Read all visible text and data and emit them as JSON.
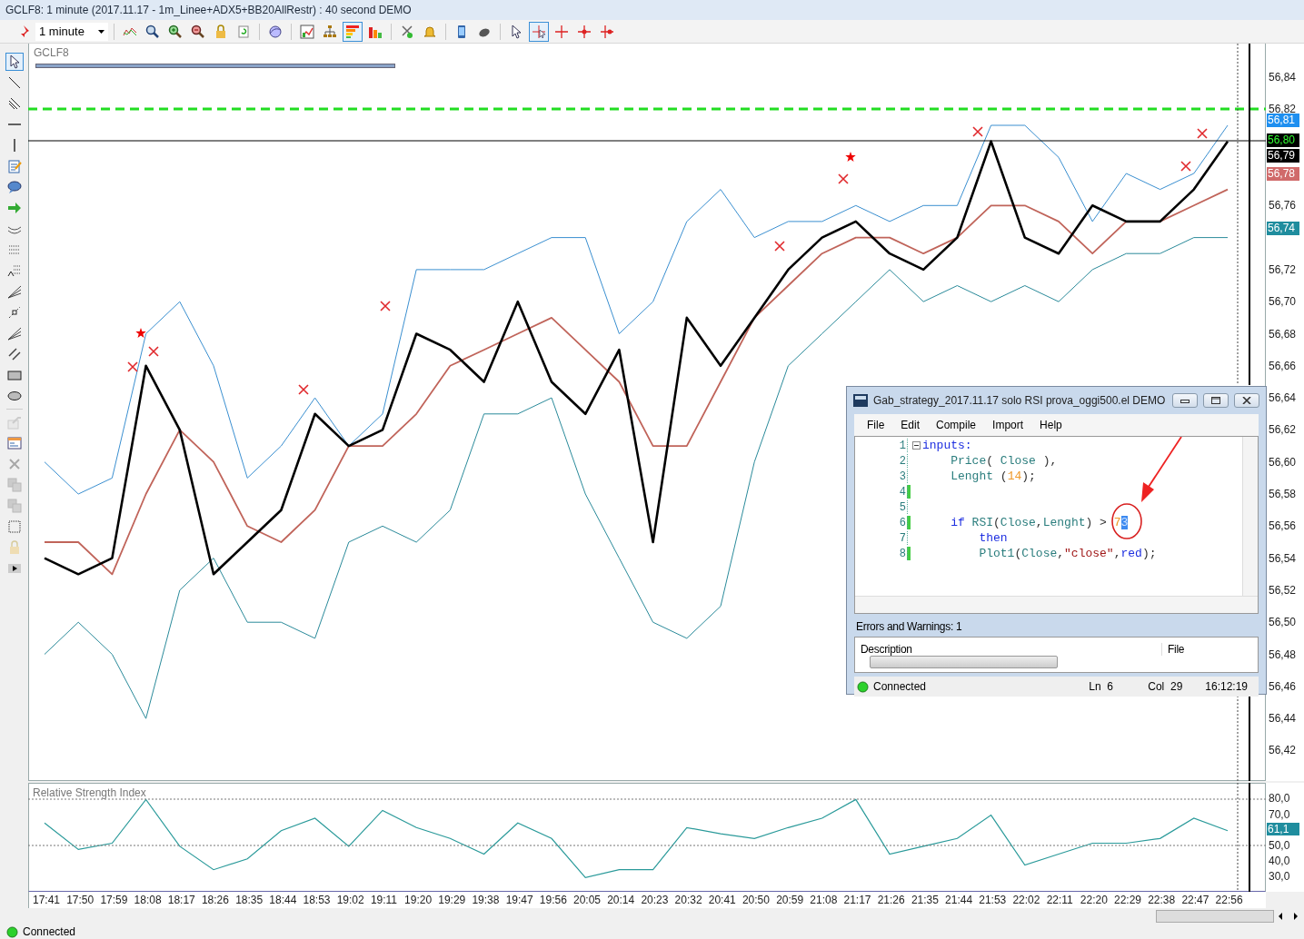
{
  "window": {
    "title": "GCLF8: 1 minute (2017.11.17 - 1m_Linee+ADX5+BB20AllRestr) : 40 second DEMO"
  },
  "toolbar": {
    "interval": "1 minute",
    "groups": [
      [
        {
          "kind": "pin",
          "selected": false
        }
      ],
      [
        {
          "kind": "indicator",
          "selected": false
        },
        {
          "kind": "zoom",
          "selected": false
        },
        {
          "kind": "zoom-in",
          "selected": false
        },
        {
          "kind": "zoom-out",
          "selected": false
        },
        {
          "kind": "lock",
          "selected": false
        },
        {
          "kind": "refresh",
          "selected": false
        }
      ],
      [
        {
          "kind": "globe",
          "selected": false
        }
      ],
      [
        {
          "kind": "chart",
          "selected": false
        },
        {
          "kind": "tree",
          "selected": false
        },
        {
          "kind": "colorbars",
          "selected": true
        },
        {
          "kind": "bars",
          "selected": false
        }
      ],
      [
        {
          "kind": "scissors",
          "selected": false
        },
        {
          "kind": "bell",
          "selected": false
        }
      ],
      [
        {
          "kind": "phone",
          "selected": false
        },
        {
          "kind": "mouse",
          "selected": false
        }
      ],
      [
        {
          "kind": "pointer",
          "selected": false
        },
        {
          "kind": "crosshair",
          "selected": true
        },
        {
          "kind": "cross",
          "selected": false
        },
        {
          "kind": "cross-dot",
          "selected": false
        },
        {
          "kind": "cross-dot-right",
          "selected": false
        }
      ]
    ]
  },
  "drawing_tools": [
    {
      "kind": "pointer",
      "selected": true,
      "disabled": false
    },
    {
      "kind": "line",
      "selected": false,
      "disabled": false
    },
    {
      "kind": "parallel",
      "selected": false,
      "disabled": false
    },
    {
      "kind": "hline",
      "selected": false,
      "disabled": false
    },
    {
      "kind": "vline",
      "selected": false,
      "disabled": false
    },
    {
      "kind": "note",
      "selected": false,
      "disabled": false
    },
    {
      "kind": "callout",
      "selected": false,
      "disabled": false
    },
    {
      "kind": "arrow",
      "selected": false,
      "disabled": false
    },
    {
      "kind": "arc",
      "selected": false,
      "disabled": false
    },
    {
      "kind": "dots",
      "selected": false,
      "disabled": false
    },
    {
      "kind": "fib",
      "selected": false,
      "disabled": false
    },
    {
      "kind": "fan",
      "selected": false,
      "disabled": false
    },
    {
      "kind": "segment",
      "selected": false,
      "disabled": false
    },
    {
      "kind": "fan",
      "selected": false,
      "disabled": false
    },
    {
      "kind": "channel",
      "selected": false,
      "disabled": false
    },
    {
      "kind": "rect",
      "selected": false,
      "disabled": false
    },
    {
      "kind": "ellipse",
      "selected": false,
      "disabled": false
    },
    {
      "kind": "props",
      "selected": false,
      "disabled": true
    },
    {
      "kind": "panel",
      "selected": false,
      "disabled": false
    },
    {
      "kind": "delete",
      "selected": false,
      "disabled": true
    },
    {
      "kind": "copy",
      "selected": false,
      "disabled": true
    },
    {
      "kind": "copy",
      "selected": false,
      "disabled": true
    },
    {
      "kind": "select",
      "selected": false,
      "disabled": false
    },
    {
      "kind": "lock",
      "selected": false,
      "disabled": true
    },
    {
      "kind": "expand",
      "selected": false,
      "disabled": false
    }
  ],
  "price_panel": {
    "symbol": "GCLF8",
    "chart_data": {
      "type": "line",
      "ylim": [
        56.401,
        56.861
      ],
      "yticks": [
        {
          "value": 56.84,
          "label": "56,84"
        },
        {
          "value": 56.82,
          "label": "56,82"
        },
        {
          "value": 56.76,
          "label": "56,76"
        },
        {
          "value": 56.72,
          "label": "56,72"
        },
        {
          "value": 56.7,
          "label": "56,70"
        },
        {
          "value": 56.68,
          "label": "56,68"
        },
        {
          "value": 56.66,
          "label": "56,66"
        },
        {
          "value": 56.64,
          "label": "56,64"
        },
        {
          "value": 56.62,
          "label": "56,62"
        },
        {
          "value": 56.6,
          "label": "56,60"
        },
        {
          "value": 56.58,
          "label": "56,58"
        },
        {
          "value": 56.56,
          "label": "56,56"
        },
        {
          "value": 56.54,
          "label": "56,54"
        },
        {
          "value": 56.52,
          "label": "56,52"
        },
        {
          "value": 56.5,
          "label": "56,50"
        },
        {
          "value": 56.48,
          "label": "56,48"
        },
        {
          "value": 56.46,
          "label": "56,46"
        },
        {
          "value": 56.44,
          "label": "56,44"
        },
        {
          "value": 56.42,
          "label": "56,42"
        }
      ],
      "series": [
        {
          "color": "#3a8fd0",
          "values": [
            56.6,
            56.58,
            56.59,
            56.68,
            56.7,
            56.66,
            56.59,
            56.61,
            56.64,
            56.61,
            56.63,
            56.72,
            56.72,
            56.72,
            56.73,
            56.74,
            56.74,
            56.68,
            56.7,
            56.75,
            56.77,
            56.74,
            56.75,
            56.75,
            56.76,
            56.75,
            56.76,
            56.76,
            56.81,
            56.81,
            56.79,
            56.75,
            56.78,
            56.77,
            56.78,
            56.81
          ]
        },
        {
          "color": "#2a8a9a",
          "values": [
            56.48,
            56.5,
            56.48,
            56.44,
            56.52,
            56.54,
            56.5,
            56.5,
            56.49,
            56.55,
            56.56,
            56.55,
            56.57,
            56.63,
            56.63,
            56.64,
            56.58,
            56.54,
            56.5,
            56.49,
            56.51,
            56.6,
            56.66,
            56.68,
            56.7,
            56.72,
            56.7,
            56.71,
            56.7,
            56.71,
            56.7,
            56.72,
            56.73,
            56.73,
            56.74,
            56.74
          ]
        },
        {
          "color": "#c0645a",
          "values": [
            56.55,
            56.55,
            56.53,
            56.58,
            56.62,
            56.6,
            56.56,
            56.55,
            56.57,
            56.61,
            56.61,
            56.63,
            56.66,
            56.67,
            56.68,
            56.69,
            56.67,
            56.65,
            56.61,
            56.61,
            56.65,
            56.69,
            56.71,
            56.73,
            56.74,
            56.74,
            56.73,
            56.74,
            56.76,
            56.76,
            56.75,
            56.73,
            56.75,
            56.75,
            56.76,
            56.77
          ]
        },
        {
          "color": "#000000",
          "values": [
            56.54,
            56.53,
            56.54,
            56.66,
            56.62,
            56.53,
            56.55,
            56.57,
            56.63,
            56.61,
            56.62,
            56.68,
            56.67,
            56.65,
            56.7,
            56.65,
            56.63,
            56.67,
            56.55,
            56.69,
            56.66,
            56.69,
            56.72,
            56.74,
            56.75,
            56.73,
            56.72,
            56.74,
            56.8,
            56.74,
            56.73,
            56.76,
            56.75,
            56.75,
            56.77,
            56.8
          ]
        }
      ]
    },
    "value_labels": [
      {
        "text": "56,81",
        "color": "#1e8ff0"
      },
      {
        "text": "56,80",
        "color": "#000000"
      },
      {
        "text": "56,79",
        "color": "#000000"
      },
      {
        "text": "56,78",
        "color": "#d06a6a"
      },
      {
        "text": "56,74",
        "color": "#1f8d9e"
      }
    ]
  },
  "rsi_panel": {
    "title": "Relative Strength Index",
    "chart_data": {
      "type": "line",
      "categories": [
        "17:41",
        "17:50",
        "17:59",
        "18:08",
        "18:17",
        "18:26",
        "18:35",
        "18:44",
        "18:53",
        "19:02",
        "19:11",
        "19:20",
        "19:29",
        "19:38",
        "19:47",
        "19:56",
        "20:05",
        "20:14",
        "20:23",
        "20:32",
        "20:41",
        "20:50",
        "20:59",
        "21:08",
        "21:17",
        "21:26",
        "21:35",
        "21:44",
        "21:53",
        "22:02",
        "22:11",
        "22:20",
        "22:29",
        "22:38",
        "22:47",
        "22:56"
      ],
      "ylim": [
        20.3,
        90.1
      ],
      "yticks": [
        {
          "value": 80,
          "label": "80,0"
        },
        {
          "value": 70,
          "label": "70,0"
        },
        {
          "value": 50,
          "label": "50,0"
        },
        {
          "value": 40,
          "label": "40,0"
        },
        {
          "value": 30,
          "label": "30,0"
        }
      ],
      "series": [
        {
          "color": "#2a9a9a",
          "values": [
            65,
            48,
            52,
            80,
            50,
            35,
            42,
            60,
            68,
            50,
            73,
            62,
            55,
            45,
            65,
            55,
            30,
            35,
            35,
            62,
            58,
            55,
            62,
            68,
            80,
            45,
            50,
            55,
            70,
            38,
            45,
            52,
            52,
            55,
            68,
            60
          ]
        }
      ]
    },
    "value_label": {
      "text": "61,1",
      "color": "#1f8d9e"
    }
  },
  "editor": {
    "title": "Gab_strategy_2017.11.17 solo RSI prova_oggi500.el DEMO",
    "menu": [
      "File",
      "Edit",
      "Compile",
      "Import",
      "Help"
    ],
    "lines": [
      {
        "number": "1",
        "modified": false,
        "fold": true,
        "tokens": [
          {
            "kind": "keyword",
            "text": "inputs:"
          }
        ]
      },
      {
        "number": "2",
        "modified": false,
        "fold": false,
        "tokens": [
          {
            "kind": "identifier",
            "text": "    Price"
          },
          {
            "kind": "punctuation",
            "text": "( "
          },
          {
            "kind": "identifier",
            "text": "Close"
          },
          {
            "kind": "punctuation",
            "text": " ),"
          }
        ]
      },
      {
        "number": "3",
        "modified": false,
        "fold": false,
        "tokens": [
          {
            "kind": "identifier",
            "text": "    Lenght"
          },
          {
            "kind": "punctuation",
            "text": " ("
          },
          {
            "kind": "number",
            "text": "14"
          },
          {
            "kind": "punctuation",
            "text": ");"
          }
        ]
      },
      {
        "number": "4",
        "modified": true,
        "fold": false
      },
      {
        "number": "5",
        "modified": false,
        "fold": false
      },
      {
        "number": "6",
        "modified": true,
        "fold": false,
        "tokens": [
          {
            "kind": "keyword",
            "text": "    if"
          },
          {
            "kind": "identifier",
            "text": " RSI"
          },
          {
            "kind": "punctuation",
            "text": "("
          },
          {
            "kind": "identifier",
            "text": "Close"
          },
          {
            "kind": "punctuation",
            "text": ","
          },
          {
            "kind": "identifier",
            "text": "Lenght"
          },
          {
            "kind": "punctuation",
            "text": ") > "
          },
          {
            "kind": "number",
            "text": "7"
          },
          {
            "kind": "selection",
            "text": "3"
          }
        ]
      },
      {
        "number": "7",
        "modified": false,
        "fold": false,
        "tokens": [
          {
            "kind": "keyword",
            "text": "        then"
          }
        ]
      },
      {
        "number": "8",
        "modified": true,
        "fold": false,
        "tokens": [
          {
            "kind": "identifier",
            "text": "        Plot1"
          },
          {
            "kind": "punctuation",
            "text": "("
          },
          {
            "kind": "identifier",
            "text": "Close"
          },
          {
            "kind": "punctuation",
            "text": ","
          },
          {
            "kind": "string",
            "text": "\"close\""
          },
          {
            "kind": "punctuation",
            "text": ","
          },
          {
            "kind": "keyword",
            "text": "red"
          },
          {
            "kind": "punctuation",
            "text": ");"
          }
        ]
      }
    ],
    "errors_label": "Errors and Warnings: 1",
    "columns": [
      "Description",
      "File"
    ],
    "status": {
      "connection": "Connected",
      "connected": true,
      "line": "Ln  6",
      "column": "Col  29",
      "time": "16:12:19"
    }
  },
  "status_bar": {
    "connection": "Connected",
    "connected": true
  }
}
